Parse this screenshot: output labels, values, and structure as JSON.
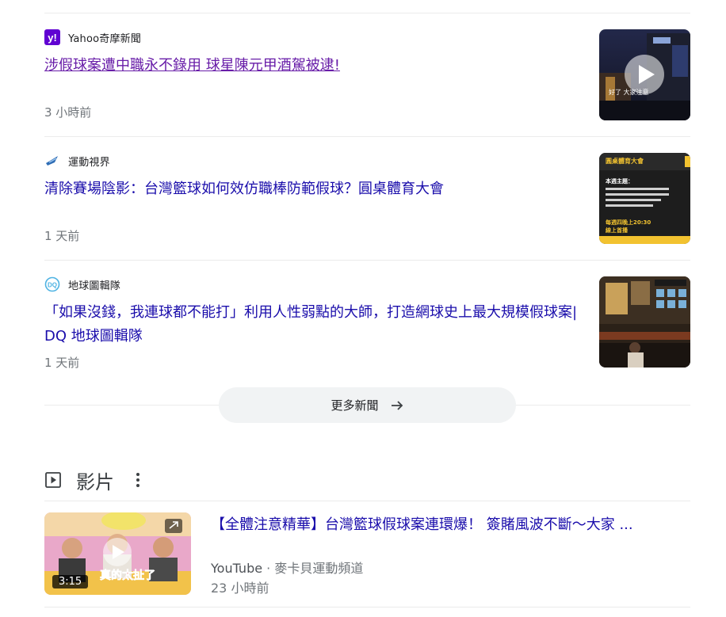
{
  "news": [
    {
      "source": "Yahoo奇摩新聞",
      "source_icon": "yahoo-logo-icon",
      "headline": "涉假球案遭中職永不錄用 球星陳元甲酒駕被逮!",
      "age": "3 小時前",
      "visited": true,
      "thumb_overlay": "好了 大家注意"
    },
    {
      "source": "運動視界",
      "source_icon": "sportsv-logo-icon",
      "headline": "清除賽場陰影：台灣籃球如何效仿職棒防範假球？圓桌體育大會",
      "age": "1 天前",
      "visited": false,
      "thumb_lines": [
        "圓桌體育大會",
        "本週主題：",
        "每週四晚上20:30",
        "線上首播"
      ]
    },
    {
      "source": "地球圖輯隊",
      "source_icon": "dq-logo-icon",
      "headline": "「如果沒錢，我連球都不能打」利用人性弱點的大師，打造網球史上最大規模假球案| DQ 地球圖輯隊",
      "age": "1 天前",
      "visited": false
    }
  ],
  "more_news_label": "更多新聞",
  "videos": {
    "title": "影片",
    "items": [
      {
        "title": "【全體注意精華】台灣籃球假球案連環爆！ 簽賭風波不斷～大家 ...",
        "platform": "YouTube",
        "separator": " · ",
        "channel": "麥卡貝運動頻道",
        "age": "23 小時前",
        "duration": "3:15",
        "overlay_text": "真的太扯了"
      }
    ]
  },
  "colors": {
    "link": "#1a0dab",
    "visited": "#681da8",
    "meta": "#70757a",
    "yahoo": "#6001d2",
    "dq": "#4fb3e3"
  }
}
